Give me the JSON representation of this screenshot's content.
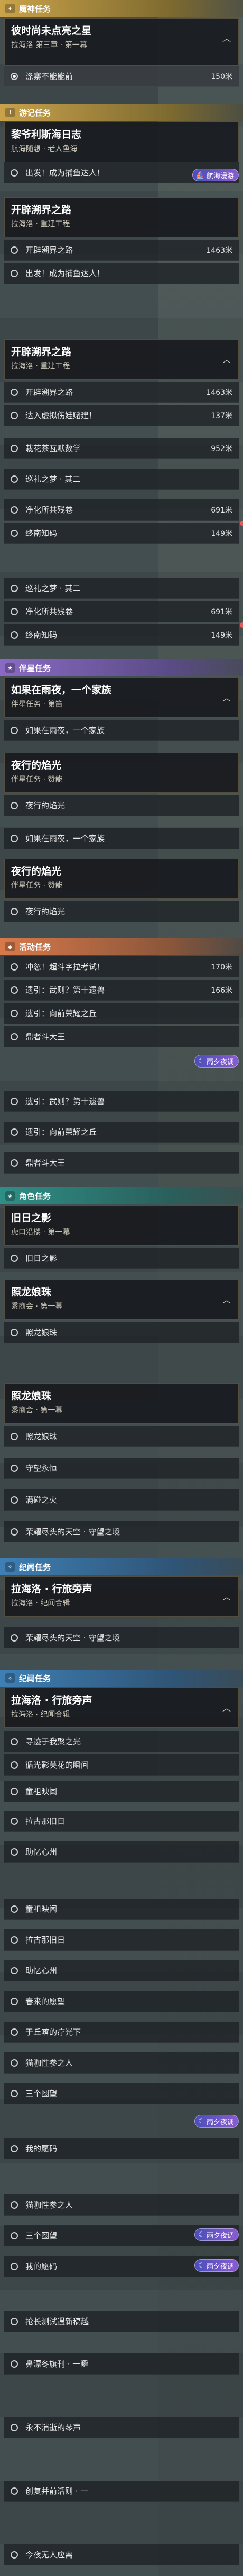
{
  "colors": {
    "main": "#caa34a",
    "world": "#c9a24b",
    "partner": "#8a6ac4",
    "event": "#d8794a",
    "explore": "#2e8f86",
    "record": "#3e7fb4",
    "alert": "#e35b5b"
  },
  "categories": {
    "main": "魔神任务",
    "world1": "游记任务",
    "partner": "伴星任务",
    "event": "活动任务",
    "explore": "角色任务",
    "record1": "纪闻任务",
    "record2": "纪闻任务"
  },
  "quests": {
    "q1": {
      "title": "彼时尚未点亮之星",
      "sub": "拉海洛 第三章 · 第一幕"
    },
    "q2": {
      "title": "黎爷利斯海日志",
      "sub": "航海随想 · 老人鱼海"
    },
    "q3": {
      "title": "开辟溯界之路",
      "sub": "拉海洛 · 重建工程"
    },
    "q4": {
      "title": "开辟溯界之路",
      "sub": "拉海洛 · 重建工程"
    },
    "q5": {
      "title": "如果在雨夜，一个家族",
      "sub": "伴星任务 · 第笛"
    },
    "q6": {
      "title": "夜行的焰光",
      "sub": "伴星任务 · 赞能"
    },
    "q7": {
      "title": "夜行的焰光",
      "sub": "伴星任务 · 赞能"
    },
    "q8": {
      "title": "旧日之影",
      "sub": "虎口沿楼 · 第一幕"
    },
    "q9": {
      "title": "照龙娘珠",
      "sub": "黍商会 · 第一幕"
    },
    "q10": {
      "title": "照龙娘珠",
      "sub": "黍商会 · 第一幕"
    },
    "q11": {
      "title": "拉海洛 · 行旅旁声",
      "sub": "拉海洛 · 纪闻合辑"
    },
    "q12": {
      "title": "拉海洛 · 行旅旁声",
      "sub": "拉海洛 · 纪闻合辑"
    }
  },
  "badges": {
    "sea": "航海漫游",
    "night": "雨夕夜调"
  },
  "steps": [
    {
      "label": "涤寨不能能前",
      "dist": "150米"
    },
    {
      "label": "出发！成为捕鱼达人！",
      "dist": ""
    },
    {
      "label": "开辟溯界之路",
      "dist": "1463米"
    },
    {
      "label": "出发！成为捕鱼达人！",
      "dist": ""
    },
    {
      "label": "开辟溯界之路",
      "dist": "1463米"
    },
    {
      "label": "达入虚拟伤娃赌建！",
      "dist": "137米"
    },
    {
      "label": "栽花茶瓦默数学",
      "dist": "952米"
    },
    {
      "label": "巡礼之梦 · 其二",
      "dist": ""
    },
    {
      "label": "净化所共残卷",
      "dist": "691米"
    },
    {
      "label": "终南知码",
      "dist": "149米"
    },
    {
      "label": "巡礼之梦 · 其二",
      "dist": ""
    },
    {
      "label": "净化所共残卷",
      "dist": "691米"
    },
    {
      "label": "终南知码",
      "dist": "149米"
    },
    {
      "label": "如果在雨夜，一个家族",
      "dist": ""
    },
    {
      "label": "夜行的焰光",
      "dist": ""
    },
    {
      "label": "如果在雨夜，一个家族",
      "dist": ""
    },
    {
      "label": "夜行的焰光",
      "dist": ""
    },
    {
      "label": "冲忽！超斗字拉考试！",
      "dist": "170米"
    },
    {
      "label": "遗引：武则？第十遗兽",
      "dist": "166米"
    },
    {
      "label": "遗引：向前荣耀之丘",
      "dist": ""
    },
    {
      "label": "鼎者斗大王",
      "dist": ""
    },
    {
      "label": "遗引：武则？第十遗兽",
      "dist": ""
    },
    {
      "label": "遗引：向前荣耀之丘",
      "dist": ""
    },
    {
      "label": "鼎者斗大王",
      "dist": ""
    },
    {
      "label": "旧日之影",
      "dist": ""
    },
    {
      "label": "照龙娘珠",
      "dist": ""
    },
    {
      "label": "照龙娘珠",
      "dist": ""
    },
    {
      "label": "守望永恒",
      "dist": ""
    },
    {
      "label": "满碰之火",
      "dist": ""
    },
    {
      "label": "荣耀尽头的天空 · 守望之境",
      "dist": ""
    },
    {
      "label": "荣耀尽头的天空 · 守望之境",
      "dist": ""
    },
    {
      "label": "寻迹于我聚之光",
      "dist": ""
    },
    {
      "label": "循光影芙花的瞬间",
      "dist": ""
    },
    {
      "label": "童祖映闻",
      "dist": ""
    },
    {
      "label": "拉古那旧日",
      "dist": ""
    },
    {
      "label": "助忆心州",
      "dist": ""
    },
    {
      "label": "童祖映闻",
      "dist": ""
    },
    {
      "label": "拉古那旧日",
      "dist": ""
    },
    {
      "label": "助忆心州",
      "dist": ""
    },
    {
      "label": "春来的愿望",
      "dist": ""
    },
    {
      "label": "于丘喀的疗光下",
      "dist": ""
    },
    {
      "label": "猫咖性参之人",
      "dist": ""
    },
    {
      "label": "三个圈望",
      "dist": ""
    },
    {
      "label": "我的愿码",
      "dist": ""
    },
    {
      "label": "猫咖性参之人",
      "dist": ""
    },
    {
      "label": "三个圈望",
      "dist": ""
    },
    {
      "label": "我的愿码",
      "dist": ""
    },
    {
      "label": "抢长测试遇新稿越",
      "dist": ""
    },
    {
      "label": "鼻漂冬旗刊 · 一瞬",
      "dist": ""
    },
    {
      "label": "永不消逝的琴声",
      "dist": ""
    },
    {
      "label": "创复并前活则 · 一",
      "dist": ""
    },
    {
      "label": "今夜无人应离",
      "dist": ""
    }
  ]
}
